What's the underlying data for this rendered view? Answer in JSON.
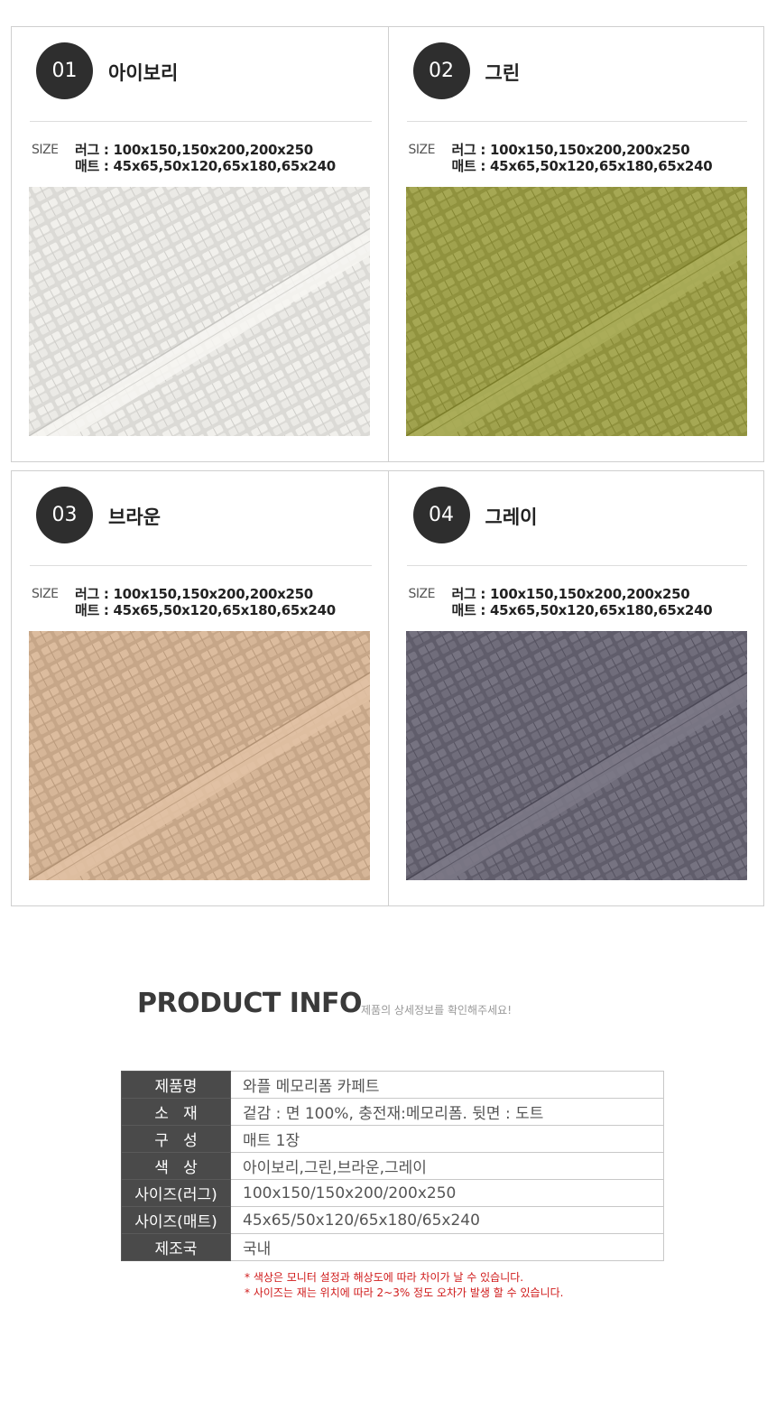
{
  "colors": {
    "ivory": "#e9e8e4",
    "green": "#9ea04c",
    "brown": "#d4b496",
    "gray": "#6e6b79",
    "badge": "#2e2e2e",
    "note": "#d01b1b"
  },
  "options": [
    {
      "number": "01",
      "name": "아이보리",
      "size_label": "SIZE",
      "rug": "러그 : 100x150,150x200,200x250",
      "mat": "매트 : 45x65,50x120,65x180,65x240",
      "swatch": "ivory"
    },
    {
      "number": "02",
      "name": "그린",
      "size_label": "SIZE",
      "rug": "러그 : 100x150,150x200,200x250",
      "mat": "매트 : 45x65,50x120,65x180,65x240",
      "swatch": "green"
    },
    {
      "number": "03",
      "name": "브라운",
      "size_label": "SIZE",
      "rug": "러그 : 100x150,150x200,200x250",
      "mat": "매트 : 45x65,50x120,65x180,65x240",
      "swatch": "brown"
    },
    {
      "number": "04",
      "name": "그레이",
      "size_label": "SIZE",
      "rug": "러그 : 100x150,150x200,200x250",
      "mat": "매트 : 45x65,50x120,65x180,65x240",
      "swatch": "gray"
    }
  ],
  "product_info": {
    "title": "PRODUCT INFO",
    "subtitle": "제품의 상세정보를 확인해주세요!",
    "rows": [
      {
        "key": "제품명",
        "value": "와플 메모리폼 카페트"
      },
      {
        "key": "소   재",
        "value": "겉감 : 면 100%, 충전재:메모리폼. 뒷면 : 도트"
      },
      {
        "key": "구   성",
        "value": "매트 1장"
      },
      {
        "key": "색   상",
        "value": "아이보리,그린,브라운,그레이"
      },
      {
        "key": "사이즈(러그)",
        "value": "100x150/150x200/200x250"
      },
      {
        "key": "사이즈(매트)",
        "value": "45x65/50x120/65x180/65x240"
      },
      {
        "key": "제조국",
        "value": "국내"
      }
    ],
    "notes": [
      "* 색상은 모니터 설정과 해상도에 따라 차이가 날 수 있습니다.",
      "* 사이즈는 재는 위치에 따라 2~3% 정도 오차가 발생 할 수 있습니다."
    ]
  }
}
